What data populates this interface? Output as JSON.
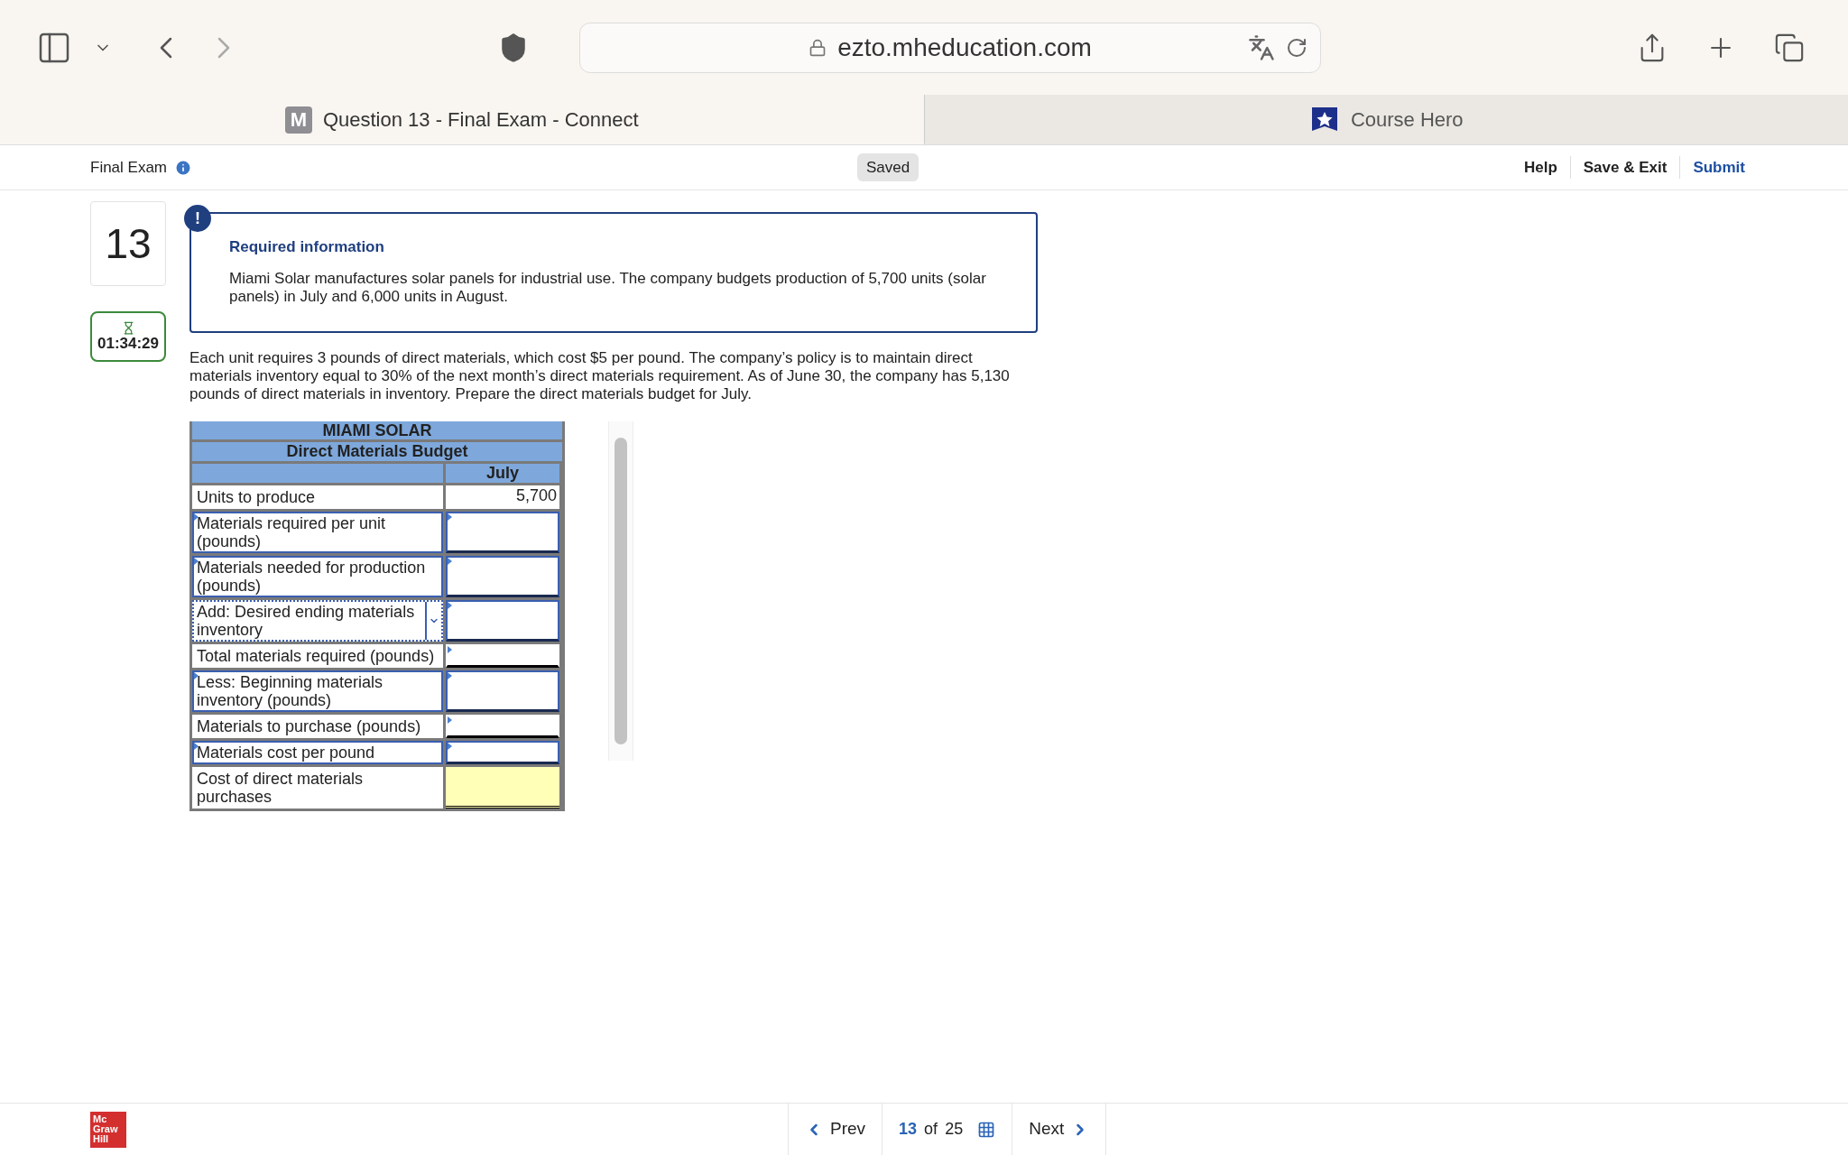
{
  "browser": {
    "url": "ezto.mheducation.com"
  },
  "tabs": [
    {
      "favicon": "M",
      "label": "Question 13 - Final Exam - Connect",
      "selected": true
    },
    {
      "label": "Course Hero",
      "selected": false
    }
  ],
  "header": {
    "title": "Final Exam",
    "status": "Saved",
    "actions": [
      {
        "label": "Help",
        "kind": "plain"
      },
      {
        "label": "Save & Exit",
        "kind": "plain"
      },
      {
        "label": "Submit",
        "kind": "primary"
      }
    ]
  },
  "question": {
    "number": "13",
    "timer": "01:34:29",
    "notice": {
      "icon": "!",
      "title": "Required information",
      "text": "Miami Solar manufactures solar panels for industrial use. The company budgets production of 5,700 units (solar panels) in July and 6,000 units in August."
    },
    "prompt": "Each unit requires 3 pounds of direct materials, which cost $5 per pound. The company’s policy is to maintain direct materials inventory equal to 30% of the next month’s direct materials requirement. As of June 30, the company has 5,130 pounds of direct materials in inventory. Prepare the direct materials budget for July.",
    "table": {
      "company": "MIAMI SOLAR",
      "title": "Direct Materials Budget",
      "column": "July",
      "rows": [
        {
          "label": "Units to produce",
          "kind": "given",
          "value": "5,700"
        },
        {
          "label": "Materials required per unit (pounds)",
          "kind": "input"
        },
        {
          "label": "Materials needed for production (pounds)",
          "kind": "input"
        },
        {
          "label": "Add: Desired ending materials inventory",
          "kind": "select"
        },
        {
          "label": "Total materials required (pounds)",
          "kind": "calc"
        },
        {
          "label": "Less: Beginning materials inventory (pounds)",
          "kind": "input"
        },
        {
          "label": "Materials to purchase (pounds)",
          "kind": "calc"
        },
        {
          "label": "Materials cost per pound",
          "kind": "input"
        },
        {
          "label": "Cost of direct materials purchases",
          "kind": "answer"
        }
      ]
    }
  },
  "footer": {
    "logo": [
      "Mc",
      "Graw",
      "Hill"
    ],
    "prev": "Prev",
    "current": "13",
    "of": "of",
    "total": "25",
    "next": "Next"
  }
}
